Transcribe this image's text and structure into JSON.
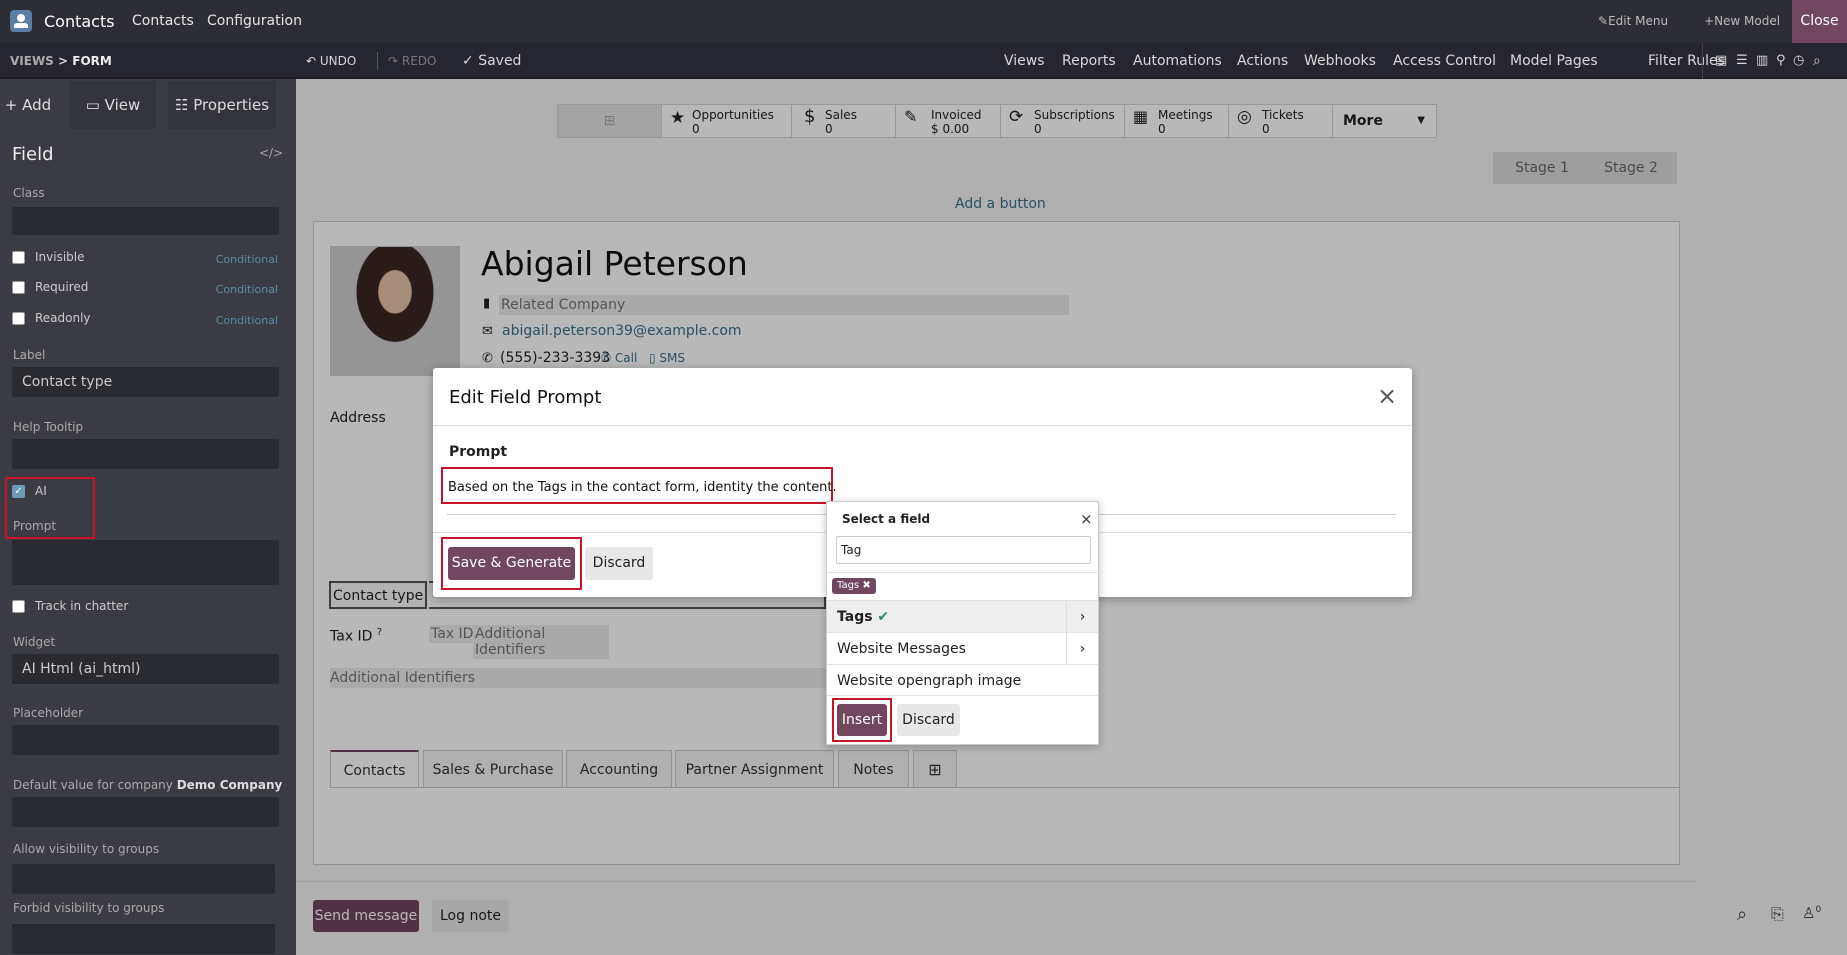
{
  "topbar": {
    "app": "Contacts",
    "menu": [
      "Contacts",
      "Configuration"
    ],
    "edit_menu": "Edit Menu",
    "new_model": "New Model",
    "close": "Close"
  },
  "subbar": {
    "breadcrumb_views": "VIEWS",
    "breadcrumb_sep": ">",
    "breadcrumb_form": "FORM",
    "undo": "UNDO",
    "redo": "REDO",
    "saved": "Saved",
    "nav": [
      "Views",
      "Reports",
      "Automations",
      "Actions",
      "Webhooks",
      "Access Control",
      "Model Pages",
      "Filter Rules"
    ]
  },
  "sidebar": {
    "tabs": [
      "Add",
      "View",
      "Properties"
    ],
    "title": "Field",
    "code": "</>",
    "class_label": "Class",
    "invisible": "Invisible",
    "required": "Required",
    "readonly": "Readonly",
    "conditional": "Conditional",
    "label_label": "Label",
    "label_value": "Contact type",
    "help_label": "Help Tooltip",
    "ai": "AI",
    "prompt_label": "Prompt",
    "track": "Track in chatter",
    "widget_label": "Widget",
    "widget_value": "AI Html (ai_html)",
    "placeholder_label": "Placeholder",
    "default_label": "Default value for company",
    "default_company": "Demo Company",
    "allow_label": "Allow visibility to groups",
    "forbid_label": "Forbid visibility to groups"
  },
  "stat": [
    {
      "label": "Opportunities",
      "value": "0"
    },
    {
      "label": "Sales",
      "value": "0"
    },
    {
      "label": "Invoiced",
      "value": "$ 0.00"
    },
    {
      "label": "Subscriptions",
      "value": "0"
    },
    {
      "label": "Meetings",
      "value": "0"
    },
    {
      "label": "Tickets",
      "value": "0"
    }
  ],
  "stat_more": "More",
  "stages": [
    "Stage 1",
    "Stage 2"
  ],
  "add_button": "Add a button",
  "contact": {
    "name": "Abigail Peterson",
    "company_placeholder": "Related Company",
    "email": "abigail.peterson39@example.com",
    "phone": "(555)-233-3393",
    "call": "Call",
    "sms": "SMS"
  },
  "form_labels": {
    "address": "Address",
    "contact_type": "Contact type",
    "tax_id": "Tax ID",
    "tax_q": "?",
    "tax_placeholder": "Tax ID",
    "additional_1": "Additional Identifiers",
    "additional_2": "Additional Identifiers"
  },
  "form_tabs": [
    "Contacts",
    "Sales & Purchase",
    "Accounting",
    "Partner Assignment",
    "Notes"
  ],
  "modal": {
    "title": "Edit Field Prompt",
    "prompt_label": "Prompt",
    "prompt_text": "Based on the Tags in the contact form, identity the content.",
    "save": "Save & Generate",
    "discard": "Discard"
  },
  "popup": {
    "title": "Select a field",
    "search": "Tag",
    "chip": "Tags",
    "rows": [
      "Tags",
      "Website Messages",
      "Website opengraph image"
    ],
    "insert": "Insert",
    "discard": "Discard"
  },
  "footer": {
    "send": "Send message",
    "log": "Log note",
    "attach_count": "0"
  },
  "colors": {
    "primary": "#71465f",
    "highlight": "#c9132a",
    "topbar": "#2d2d36"
  }
}
